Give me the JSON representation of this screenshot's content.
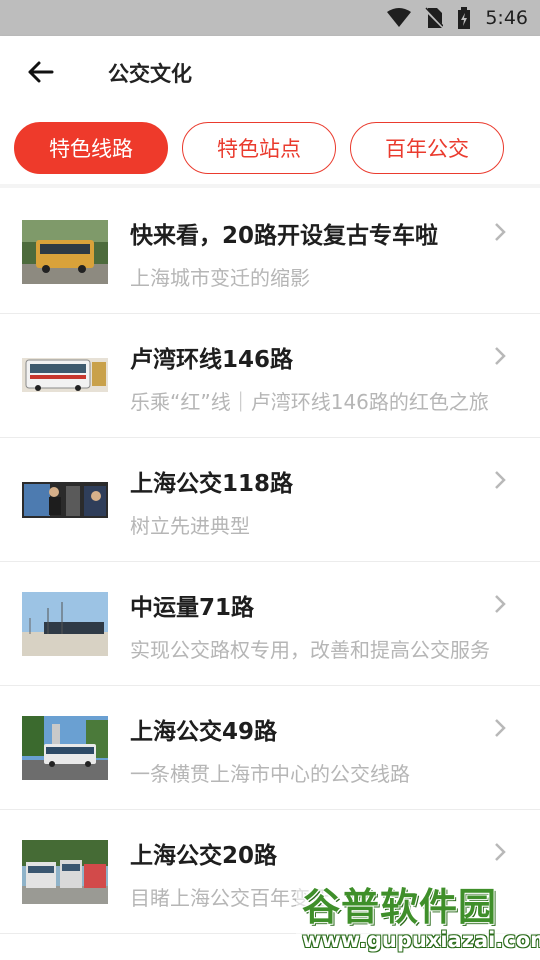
{
  "status_bar": {
    "time": "5:46",
    "icons": [
      "wifi-icon",
      "no-sim-icon",
      "battery-icon"
    ]
  },
  "header": {
    "title": "公交文化",
    "back_icon": "arrow-left-icon"
  },
  "tabs": [
    {
      "label": "特色线路",
      "active": true
    },
    {
      "label": "特色站点",
      "active": false
    },
    {
      "label": "百年公交",
      "active": false
    }
  ],
  "items": [
    {
      "title": "快来看，20路开设复古专车啦",
      "subtitle": "上海城市变迁的缩影"
    },
    {
      "title": "卢湾环线146路",
      "subtitle": "乐乘“红”线｜卢湾环线146路的红色之旅"
    },
    {
      "title": "上海公交118路",
      "subtitle": "树立先进典型"
    },
    {
      "title": "中运量71路",
      "subtitle": "实现公交路权专用，改善和提高公交服务"
    },
    {
      "title": "上海公交49路",
      "subtitle": "一条横贯上海市中心的公交线路"
    },
    {
      "title": "上海公交20路",
      "subtitle": "目睹上海公交百年变迁"
    }
  ],
  "watermark": {
    "main": "谷普软件园",
    "url": "www.gupuxiazai.com"
  },
  "colors": {
    "accent": "#ee3a2b",
    "status_bar": "#bdbdbd",
    "title": "#1e1e1e",
    "subtitle": "#b6b6b6"
  }
}
